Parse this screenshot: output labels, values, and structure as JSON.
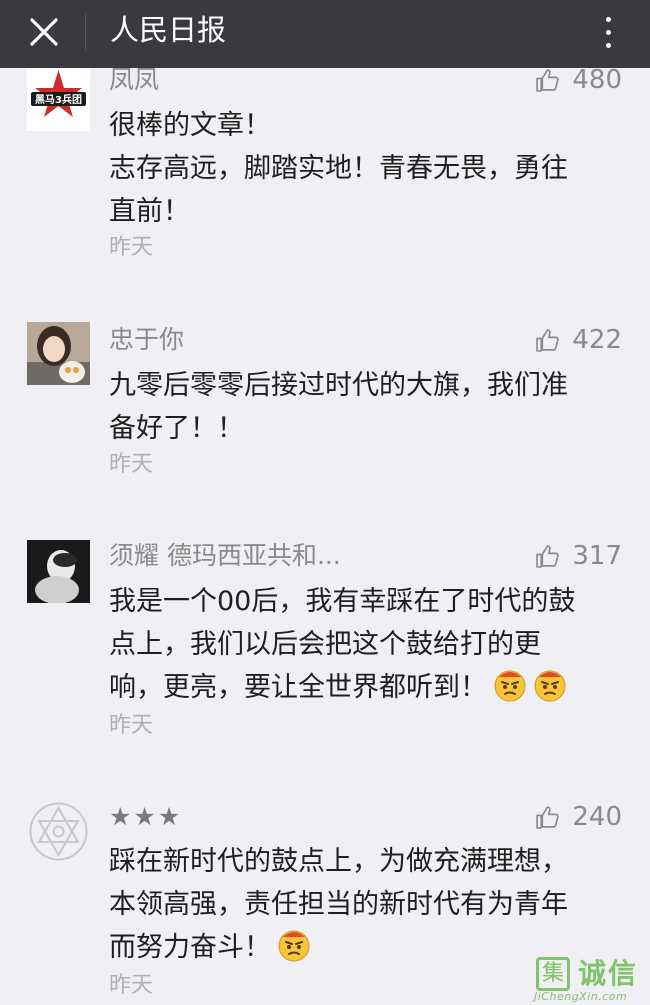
{
  "header": {
    "title": "人民日报",
    "close_icon": "close-icon",
    "more_icon": "more-vertical-icon",
    "background": "#393a3f"
  },
  "comments": [
    {
      "username": "凤凤",
      "likes": "480",
      "lines": [
        "很棒的文章！",
        "志存高远，脚踏实地！青春无畏，勇往",
        "直前！"
      ],
      "time": "昨天",
      "avatar_text": "黑马3兵团"
    },
    {
      "username": "忠于你",
      "likes": "422",
      "lines": [
        "九零后零零后接过时代的大旗，我们准",
        "备好了！！"
      ],
      "time": "昨天"
    },
    {
      "username": "须耀 德玛西亚共和...",
      "likes": "317",
      "lines": [
        "我是一个00后，我有幸踩在了时代的鼓",
        "点上，我们以后会把这个鼓给打的更",
        "响，更亮，要让全世界都听到！"
      ],
      "time": "昨天"
    },
    {
      "username": "★★★",
      "likes": "240",
      "lines": [
        "踩在新时代的鼓点上，为做充满理想，",
        "本领高强，责任担当的新时代有为青年",
        "而努力奋斗！"
      ],
      "time": "昨天"
    }
  ],
  "watermark": {
    "logo_char": "集",
    "text": "诚信",
    "sub": "JiChengXin.com"
  },
  "colors": {
    "page_bg": "#efeff4",
    "meta_gray": "#8a8a8a",
    "time_gray": "#b0b0b0",
    "watermark_green": "#7fc36b"
  }
}
